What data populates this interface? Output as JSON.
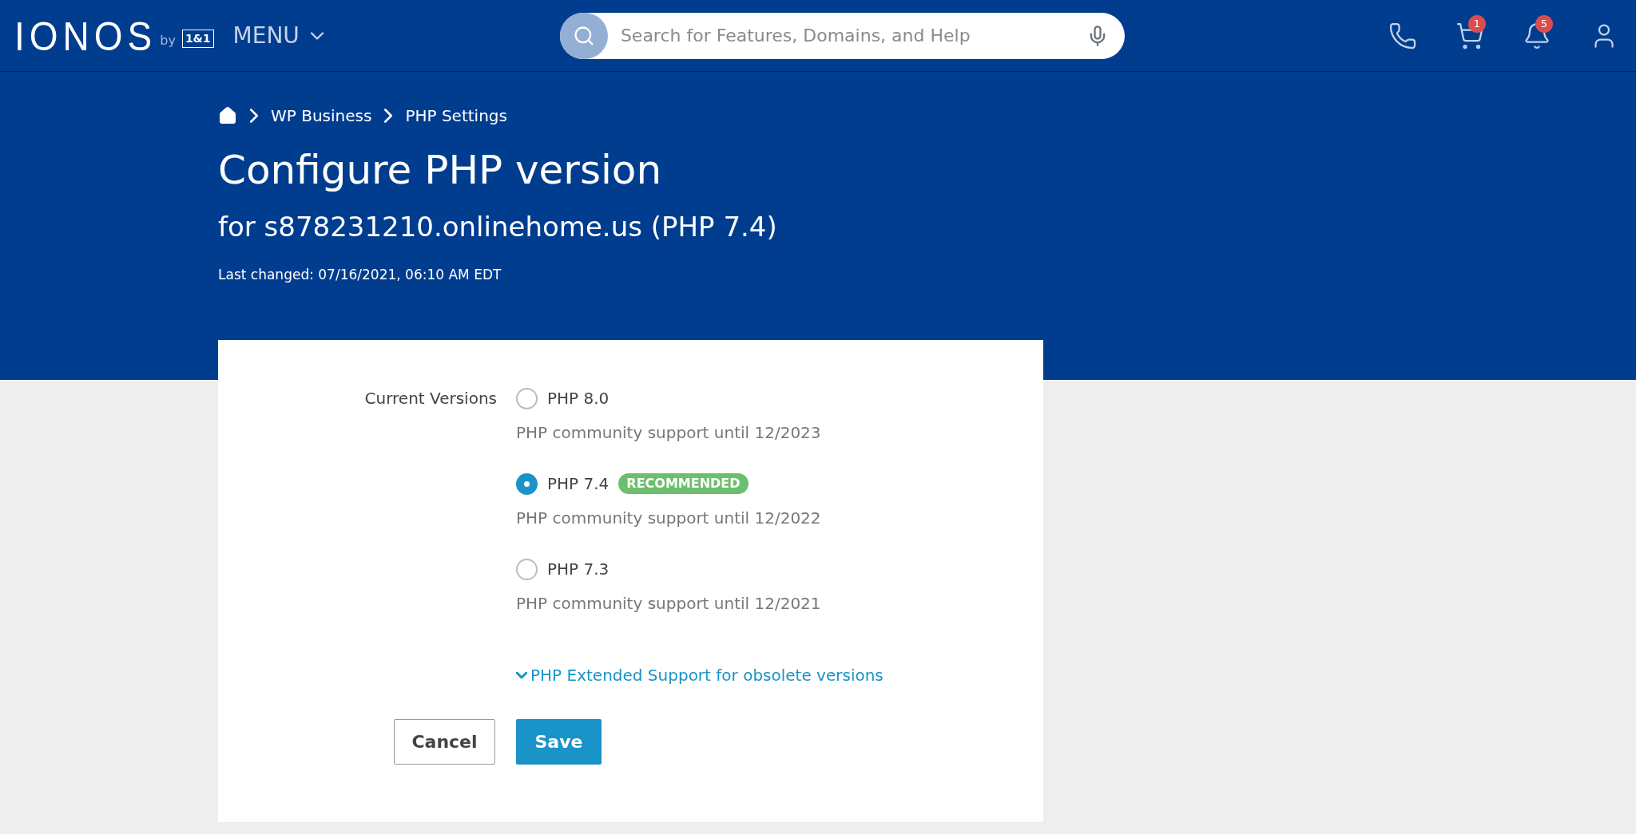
{
  "header": {
    "logo": "IONOS",
    "logo_by": "by",
    "logo_partner": "1&1",
    "menu": "MENU",
    "search": {
      "placeholder": "Search for Features, Domains, and Help"
    },
    "cart_count": "1",
    "notifications_count": "5"
  },
  "breadcrumb": [
    "WP Business",
    "PHP Settings"
  ],
  "title": "Configure PHP version",
  "subtitle": "for s878231210.onlinehome.us (PHP 7.4)",
  "last_changed": "Last changed: 07/16/2021, 06:10 AM EDT",
  "form": {
    "label": "Current Versions",
    "options": [
      {
        "label": "PHP 8.0",
        "note": "PHP community support until 12/2023",
        "selected": false
      },
      {
        "label": "PHP 7.4",
        "badge": "RECOMMENDED",
        "note": "PHP community support until 12/2022",
        "selected": true
      },
      {
        "label": "PHP 7.3",
        "note": "PHP community support until 12/2021",
        "selected": false
      }
    ],
    "extended_link": "PHP Extended Support for obsolete versions",
    "expanded": false,
    "buttons": {
      "cancel": "Cancel",
      "save": "Save"
    }
  }
}
